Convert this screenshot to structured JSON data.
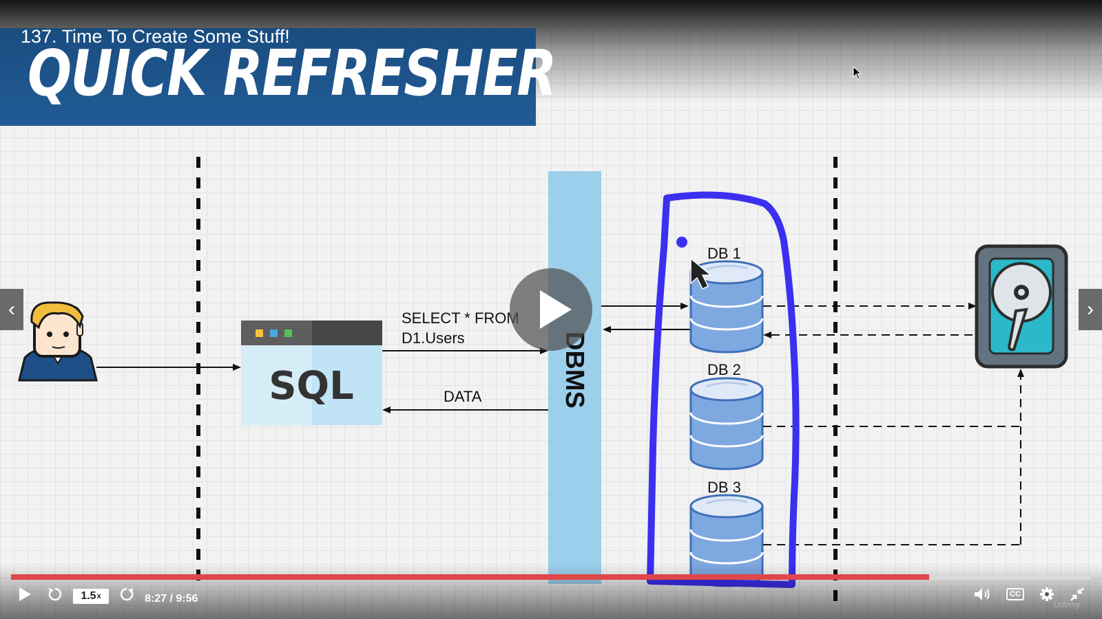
{
  "lecture": {
    "title": "137. Time To Create Some Stuff!"
  },
  "slide": {
    "banner_text": "QUICK REFRESHER",
    "query_line1": "SELECT * FROM",
    "query_line2": "D1.Users",
    "data_label": "DATA",
    "dbms_label": "DBMS",
    "sql_label": "SQL",
    "databases": [
      "DB 1",
      "DB 2",
      "DB 3"
    ],
    "colors": {
      "banner": "#215b96",
      "dbms_bar": "#9ccfec",
      "highlight": "#3b2ff0",
      "disk": "#2bb8c8",
      "db_fill": "#7ea8e0"
    }
  },
  "player": {
    "speed_label": "1.5",
    "speed_suffix": "x",
    "time_current": "8:27",
    "time_total": "9:56",
    "time_separator": " / ",
    "progress": 0.85,
    "icons": [
      "play-icon",
      "rewind-icon",
      "forward-icon",
      "volume-icon",
      "captions-icon",
      "settings-icon",
      "fullscreen-exit-icon"
    ],
    "captions_label": "CC",
    "watermark": "Udemy"
  }
}
